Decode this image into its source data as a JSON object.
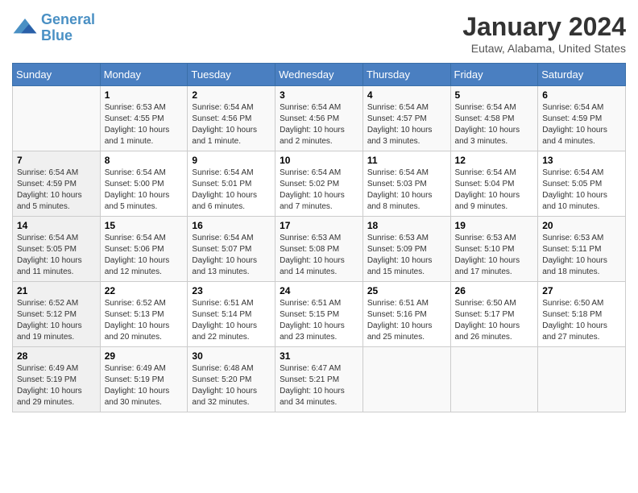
{
  "header": {
    "logo_line1": "General",
    "logo_line2": "Blue",
    "month_title": "January 2024",
    "location": "Eutaw, Alabama, United States"
  },
  "days_of_week": [
    "Sunday",
    "Monday",
    "Tuesday",
    "Wednesday",
    "Thursday",
    "Friday",
    "Saturday"
  ],
  "weeks": [
    [
      {
        "day": "",
        "info": ""
      },
      {
        "day": "1",
        "info": "Sunrise: 6:53 AM\nSunset: 4:55 PM\nDaylight: 10 hours\nand 1 minute."
      },
      {
        "day": "2",
        "info": "Sunrise: 6:54 AM\nSunset: 4:56 PM\nDaylight: 10 hours\nand 1 minute."
      },
      {
        "day": "3",
        "info": "Sunrise: 6:54 AM\nSunset: 4:56 PM\nDaylight: 10 hours\nand 2 minutes."
      },
      {
        "day": "4",
        "info": "Sunrise: 6:54 AM\nSunset: 4:57 PM\nDaylight: 10 hours\nand 3 minutes."
      },
      {
        "day": "5",
        "info": "Sunrise: 6:54 AM\nSunset: 4:58 PM\nDaylight: 10 hours\nand 3 minutes."
      },
      {
        "day": "6",
        "info": "Sunrise: 6:54 AM\nSunset: 4:59 PM\nDaylight: 10 hours\nand 4 minutes."
      }
    ],
    [
      {
        "day": "7",
        "info": "Sunrise: 6:54 AM\nSunset: 4:59 PM\nDaylight: 10 hours\nand 5 minutes."
      },
      {
        "day": "8",
        "info": "Sunrise: 6:54 AM\nSunset: 5:00 PM\nDaylight: 10 hours\nand 5 minutes."
      },
      {
        "day": "9",
        "info": "Sunrise: 6:54 AM\nSunset: 5:01 PM\nDaylight: 10 hours\nand 6 minutes."
      },
      {
        "day": "10",
        "info": "Sunrise: 6:54 AM\nSunset: 5:02 PM\nDaylight: 10 hours\nand 7 minutes."
      },
      {
        "day": "11",
        "info": "Sunrise: 6:54 AM\nSunset: 5:03 PM\nDaylight: 10 hours\nand 8 minutes."
      },
      {
        "day": "12",
        "info": "Sunrise: 6:54 AM\nSunset: 5:04 PM\nDaylight: 10 hours\nand 9 minutes."
      },
      {
        "day": "13",
        "info": "Sunrise: 6:54 AM\nSunset: 5:05 PM\nDaylight: 10 hours\nand 10 minutes."
      }
    ],
    [
      {
        "day": "14",
        "info": "Sunrise: 6:54 AM\nSunset: 5:05 PM\nDaylight: 10 hours\nand 11 minutes."
      },
      {
        "day": "15",
        "info": "Sunrise: 6:54 AM\nSunset: 5:06 PM\nDaylight: 10 hours\nand 12 minutes."
      },
      {
        "day": "16",
        "info": "Sunrise: 6:54 AM\nSunset: 5:07 PM\nDaylight: 10 hours\nand 13 minutes."
      },
      {
        "day": "17",
        "info": "Sunrise: 6:53 AM\nSunset: 5:08 PM\nDaylight: 10 hours\nand 14 minutes."
      },
      {
        "day": "18",
        "info": "Sunrise: 6:53 AM\nSunset: 5:09 PM\nDaylight: 10 hours\nand 15 minutes."
      },
      {
        "day": "19",
        "info": "Sunrise: 6:53 AM\nSunset: 5:10 PM\nDaylight: 10 hours\nand 17 minutes."
      },
      {
        "day": "20",
        "info": "Sunrise: 6:53 AM\nSunset: 5:11 PM\nDaylight: 10 hours\nand 18 minutes."
      }
    ],
    [
      {
        "day": "21",
        "info": "Sunrise: 6:52 AM\nSunset: 5:12 PM\nDaylight: 10 hours\nand 19 minutes."
      },
      {
        "day": "22",
        "info": "Sunrise: 6:52 AM\nSunset: 5:13 PM\nDaylight: 10 hours\nand 20 minutes."
      },
      {
        "day": "23",
        "info": "Sunrise: 6:51 AM\nSunset: 5:14 PM\nDaylight: 10 hours\nand 22 minutes."
      },
      {
        "day": "24",
        "info": "Sunrise: 6:51 AM\nSunset: 5:15 PM\nDaylight: 10 hours\nand 23 minutes."
      },
      {
        "day": "25",
        "info": "Sunrise: 6:51 AM\nSunset: 5:16 PM\nDaylight: 10 hours\nand 25 minutes."
      },
      {
        "day": "26",
        "info": "Sunrise: 6:50 AM\nSunset: 5:17 PM\nDaylight: 10 hours\nand 26 minutes."
      },
      {
        "day": "27",
        "info": "Sunrise: 6:50 AM\nSunset: 5:18 PM\nDaylight: 10 hours\nand 27 minutes."
      }
    ],
    [
      {
        "day": "28",
        "info": "Sunrise: 6:49 AM\nSunset: 5:19 PM\nDaylight: 10 hours\nand 29 minutes."
      },
      {
        "day": "29",
        "info": "Sunrise: 6:49 AM\nSunset: 5:19 PM\nDaylight: 10 hours\nand 30 minutes."
      },
      {
        "day": "30",
        "info": "Sunrise: 6:48 AM\nSunset: 5:20 PM\nDaylight: 10 hours\nand 32 minutes."
      },
      {
        "day": "31",
        "info": "Sunrise: 6:47 AM\nSunset: 5:21 PM\nDaylight: 10 hours\nand 34 minutes."
      },
      {
        "day": "",
        "info": ""
      },
      {
        "day": "",
        "info": ""
      },
      {
        "day": "",
        "info": ""
      }
    ]
  ]
}
